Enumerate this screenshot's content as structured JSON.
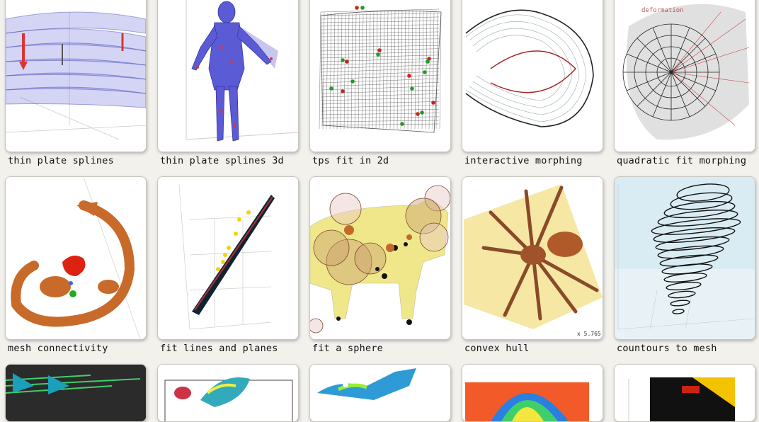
{
  "gallery": {
    "row1": [
      {
        "caption": "thin plate splines"
      },
      {
        "caption": "thin plate splines 3d"
      },
      {
        "caption": "tps fit in 2d"
      },
      {
        "caption": "interactive morphing"
      },
      {
        "caption": "quadratic fit morphing"
      }
    ],
    "row2": [
      {
        "caption": "mesh connectivity"
      },
      {
        "caption": "fit lines and planes"
      },
      {
        "caption": "fit a sphere"
      },
      {
        "caption": "convex hull"
      },
      {
        "caption": "countours to mesh"
      }
    ]
  },
  "thumb_text": {
    "deformation_label": "deformation",
    "hull_readout": "x 5.765"
  },
  "colors": {
    "page_bg": "#f3f1ec",
    "card_border": "#c9c6c0",
    "caption_text": "#111111"
  }
}
